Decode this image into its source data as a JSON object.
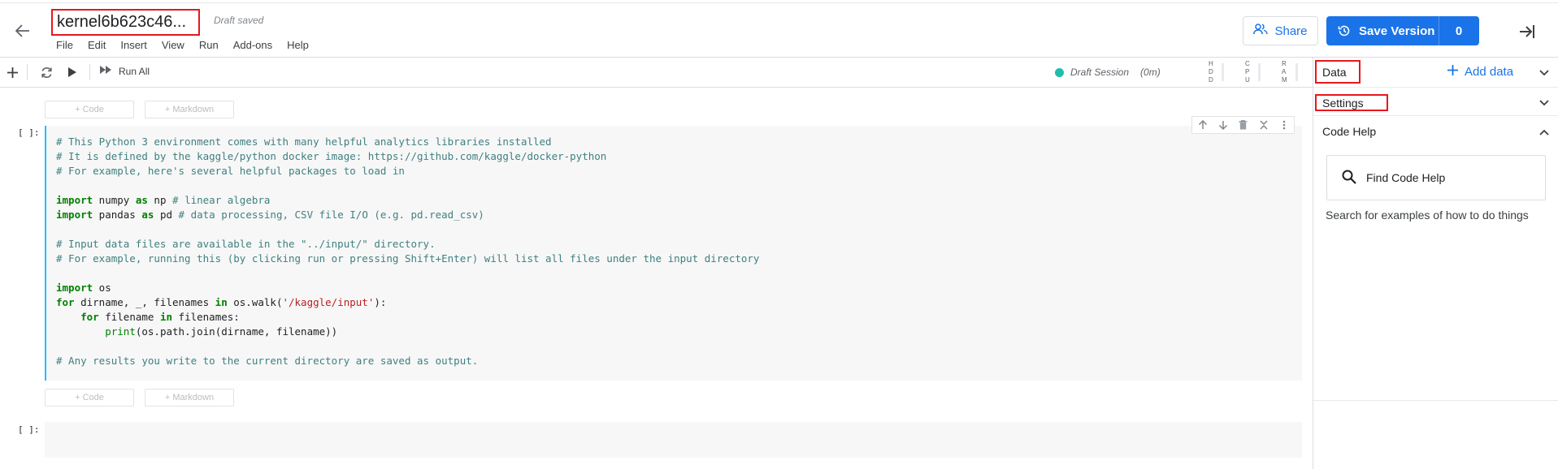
{
  "header": {
    "title": "kernel6b623c46...",
    "draft_status": "Draft saved",
    "menu": [
      "File",
      "Edit",
      "Insert",
      "View",
      "Run",
      "Add-ons",
      "Help"
    ],
    "share_label": "Share",
    "save_label": "Save Version",
    "save_count": "0"
  },
  "toolbar": {
    "run_all_label": "Run All",
    "session_label": "Draft Session",
    "session_time": "(0m)",
    "meters": [
      {
        "name": "HDD",
        "letters": [
          "H",
          "D",
          "D"
        ]
      },
      {
        "name": "CPU",
        "letters": [
          "C",
          "P",
          "U"
        ]
      },
      {
        "name": "RAM",
        "letters": [
          "R",
          "A",
          "M"
        ]
      }
    ],
    "session_color": "#20beaa"
  },
  "notebook": {
    "add_code_label": "+ Code",
    "add_markdown_label": "+ Markdown",
    "cell_prompt": "[ ]:",
    "cells": [
      {
        "lines": [
          [
            [
              "cm",
              "# This Python 3 environment comes with many helpful analytics libraries installed"
            ]
          ],
          [
            [
              "cm",
              "# It is defined by the kaggle/python docker image: https://github.com/kaggle/docker-python"
            ]
          ],
          [
            [
              "cm",
              "# For example, here's several helpful packages to load in"
            ]
          ],
          [],
          [
            [
              "kw",
              "import"
            ],
            [
              "",
              " numpy "
            ],
            [
              "kw",
              "as"
            ],
            [
              "",
              " np "
            ],
            [
              "cm",
              "# linear algebra"
            ]
          ],
          [
            [
              "kw",
              "import"
            ],
            [
              "",
              " pandas "
            ],
            [
              "kw",
              "as"
            ],
            [
              "",
              " pd "
            ],
            [
              "cm",
              "# data processing, CSV file I/O (e.g. pd.read_csv)"
            ]
          ],
          [],
          [
            [
              "cm",
              "# Input data files are available in the \"../input/\" directory."
            ]
          ],
          [
            [
              "cm",
              "# For example, running this (by clicking run or pressing Shift+Enter) will list all files under the input directory"
            ]
          ],
          [],
          [
            [
              "kw",
              "import"
            ],
            [
              "",
              " os"
            ]
          ],
          [
            [
              "kw",
              "for"
            ],
            [
              "",
              " dirname, _, filenames "
            ],
            [
              "kw",
              "in"
            ],
            [
              "",
              " os.walk("
            ],
            [
              "str",
              "'/kaggle/input'"
            ],
            [
              "",
              "):"
            ]
          ],
          [
            [
              "",
              "    "
            ],
            [
              "kw",
              "for"
            ],
            [
              "",
              " filename "
            ],
            [
              "kw",
              "in"
            ],
            [
              "",
              " filenames:"
            ]
          ],
          [
            [
              "",
              "        "
            ],
            [
              "bi",
              "print"
            ],
            [
              "",
              "(os.path.join(dirname, filename))"
            ]
          ],
          [],
          [
            [
              "cm",
              "# Any results you write to the current directory are saved as output."
            ]
          ]
        ]
      },
      {
        "lines": []
      }
    ]
  },
  "sidebar": {
    "data_label": "Data",
    "add_data_label": "Add data",
    "settings_label": "Settings",
    "code_help_label": "Code Help",
    "find_code_help_label": "Find Code Help",
    "code_help_desc": "Search for examples of how to do things"
  },
  "colors": {
    "accent": "#1a73e8",
    "highlight_box": "#e8171b",
    "active_cell": "#20beff"
  }
}
